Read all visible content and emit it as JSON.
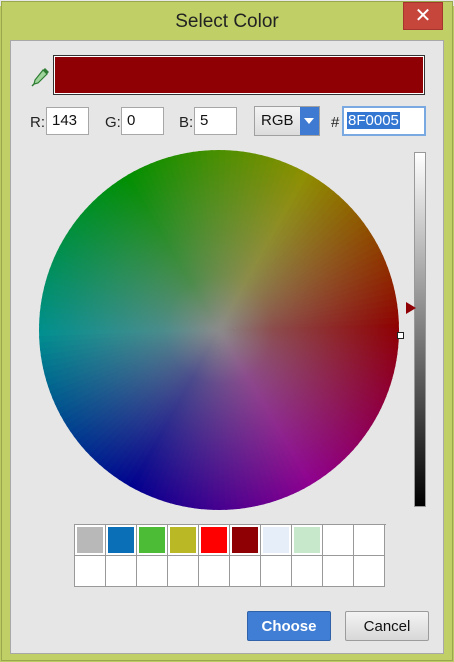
{
  "dialog": {
    "title": "Select Color",
    "close_glyph": "✕"
  },
  "current_color": "#8F0005",
  "rgb": {
    "r_label": "R:",
    "r_value": "143",
    "g_label": "G:",
    "g_value": "0",
    "b_label": "B:",
    "b_value": "5"
  },
  "mode": {
    "selected": "RGB"
  },
  "hex": {
    "label": "#",
    "value": "8F0005"
  },
  "value_slider": {
    "level": 0.56
  },
  "swatches": [
    "#b8b8b8",
    "#0b6fb8",
    "#4cbc37",
    "#bab825",
    "#ff0000",
    "#8f0005",
    "#e6eefa",
    "#c8e8cc",
    "#ffffff",
    "#ffffff",
    "#ffffff",
    "#ffffff",
    "#ffffff",
    "#ffffff",
    "#ffffff",
    "#ffffff",
    "#ffffff",
    "#ffffff",
    "#ffffff",
    "#ffffff"
  ],
  "buttons": {
    "choose": "Choose",
    "cancel": "Cancel"
  },
  "icons": {
    "eyedropper": "eyedropper-icon",
    "close": "close-icon",
    "dropdown": "chevron-down-icon"
  }
}
